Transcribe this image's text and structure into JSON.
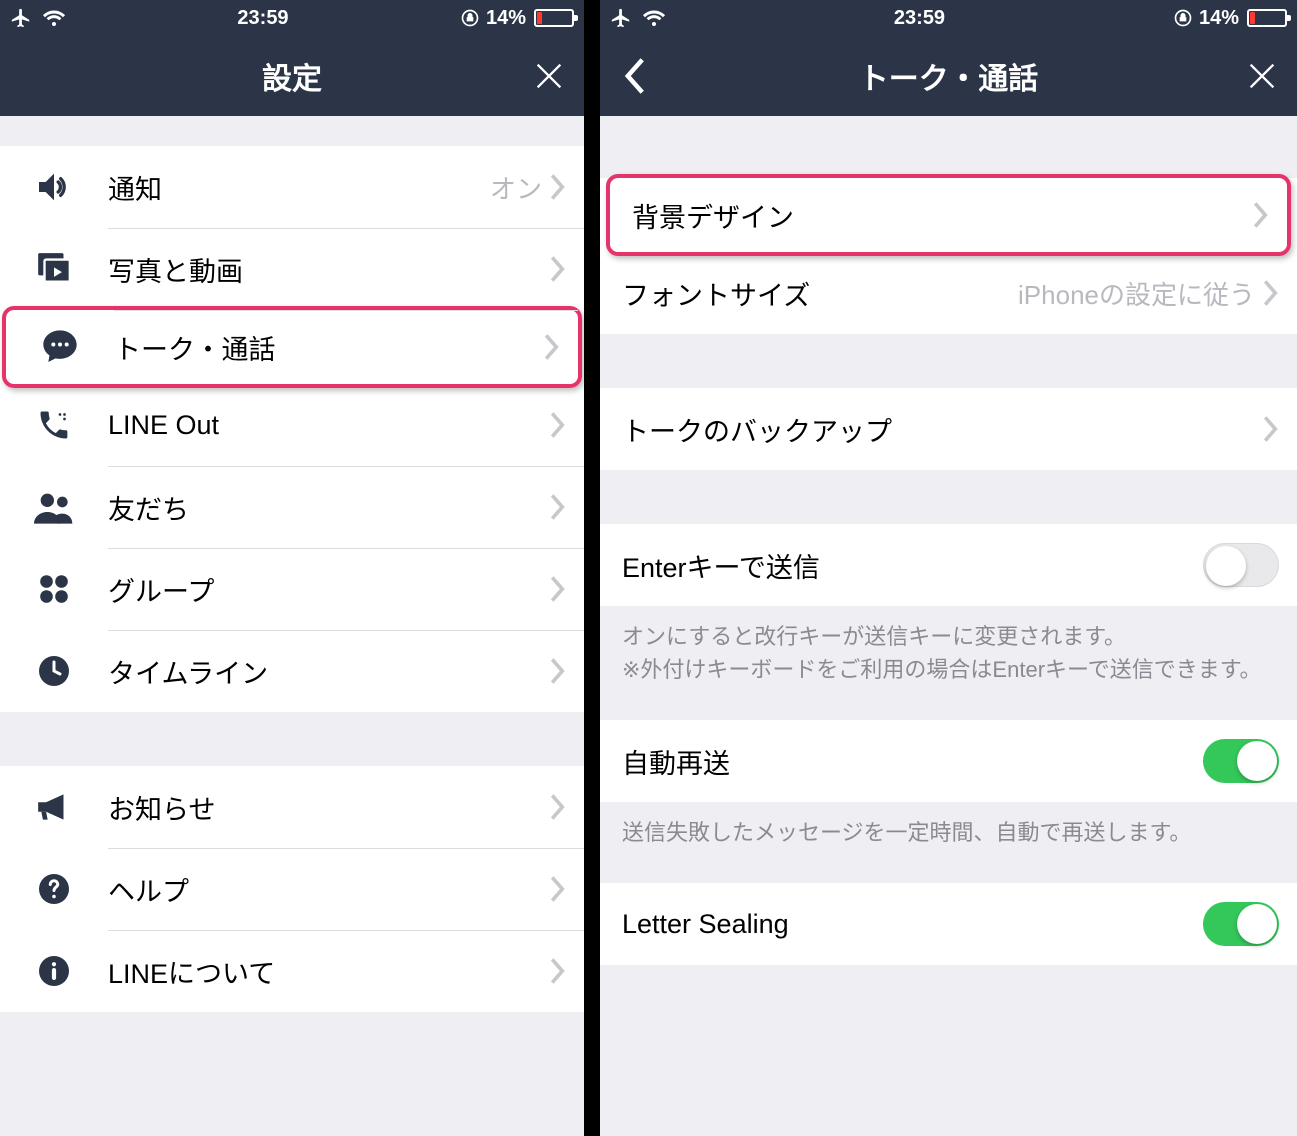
{
  "status": {
    "time": "23:59",
    "battery_pct": "14%"
  },
  "left": {
    "title": "設定",
    "group1": [
      {
        "label": "通知",
        "value": "オン"
      },
      {
        "label": "写真と動画"
      },
      {
        "label": "トーク・通話",
        "hl": true
      },
      {
        "label": "LINE Out"
      },
      {
        "label": "友だち"
      },
      {
        "label": "グループ"
      },
      {
        "label": "タイムライン"
      }
    ],
    "group2": [
      {
        "label": "お知らせ"
      },
      {
        "label": "ヘルプ"
      },
      {
        "label": "LINEについて"
      }
    ]
  },
  "right": {
    "title": "トーク・通話",
    "g1": {
      "bg": "背景デザイン",
      "font": "フォントサイズ",
      "font_value": "iPhoneの設定に従う"
    },
    "g2": {
      "backup": "トークのバックアップ"
    },
    "g3": {
      "enter": "Enterキーで送信",
      "enter_note": "オンにすると改行キーが送信キーに変更されます。\n※外付けキーボードをご利用の場合はEnterキーで送信できます。"
    },
    "g4": {
      "resend": "自動再送",
      "resend_note": "送信失敗したメッセージを一定時間、自動で再送します。"
    },
    "g5": {
      "letter": "Letter Sealing"
    }
  }
}
